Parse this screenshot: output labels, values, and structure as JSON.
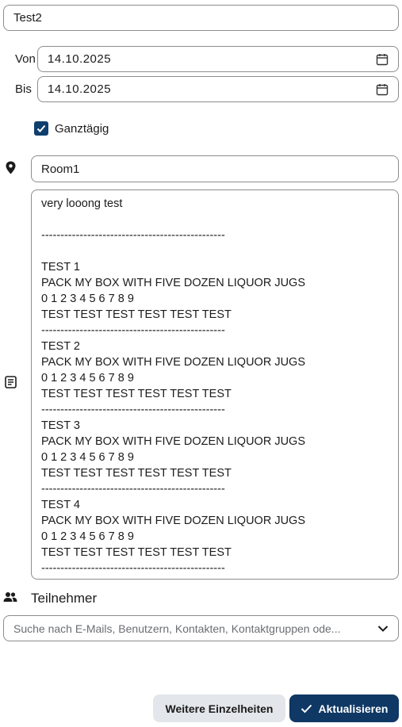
{
  "event": {
    "title": "Test2",
    "from_label": "Von",
    "from_date": "14.10.2025",
    "to_label": "Bis",
    "to_date": "14.10.2025",
    "all_day_label": "Ganztägig",
    "all_day_checked": true,
    "location": "Room1",
    "description": "very looong test\n\n------------------------------------------------\n\nTEST 1\nPACK MY BOX WITH FIVE DOZEN LIQUOR JUGS\n0 1 2 3 4 5 6 7 8 9\nTEST TEST TEST TEST TEST TEST\n------------------------------------------------\nTEST 2\nPACK MY BOX WITH FIVE DOZEN LIQUOR JUGS\n0 1 2 3 4 5 6 7 8 9\nTEST TEST TEST TEST TEST TEST\n------------------------------------------------\nTEST 3\nPACK MY BOX WITH FIVE DOZEN LIQUOR JUGS\n0 1 2 3 4 5 6 7 8 9\nTEST TEST TEST TEST TEST TEST\n------------------------------------------------\nTEST 4\nPACK MY BOX WITH FIVE DOZEN LIQUOR JUGS\n0 1 2 3 4 5 6 7 8 9\nTEST TEST TEST TEST TEST TEST\n------------------------------------------------"
  },
  "attendees": {
    "label": "Teilnehmer",
    "search_placeholder": "Suche nach E-Mails, Benutzern, Kontakten, Kontaktgruppen ode..."
  },
  "buttons": {
    "more_details": "Weitere Einzelheiten",
    "update": "Aktualisieren"
  },
  "icons": {
    "calendar": "calendar-icon",
    "location": "location-pin-icon",
    "description": "notes-icon",
    "people": "people-icon",
    "dropdown": "chevron-down-icon",
    "check": "check-icon"
  },
  "colors": {
    "primary": "#0f3864",
    "checkbox": "#0f3f6e",
    "secondary_button": "#e3e6ea",
    "border": "#8a8d91"
  }
}
